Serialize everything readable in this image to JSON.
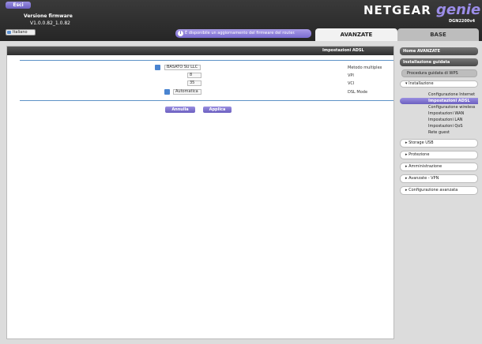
{
  "header": {
    "exit_label": "Esci",
    "firmware_label": "Versione firmware",
    "firmware_value": "V1.0.0.82_1.0.82",
    "language_value": "Italiano",
    "logo_brand": "NETGEAR",
    "logo_product": "genie",
    "model": "DGN2200v4",
    "update_notice": "È disponibile un aggiornamento del firmware del router.",
    "tabs": {
      "advanced": "AVANZATE",
      "basic": "BASE"
    }
  },
  "main": {
    "title": "Impostazioni ADSL",
    "fields": [
      {
        "label": "Metodo multiplex",
        "value": "BASATO SU LLC"
      },
      {
        "label": "VPI",
        "value": "8"
      },
      {
        "label": "VCI",
        "value": "35"
      },
      {
        "label": "DSL Mode",
        "value": "Automatica"
      }
    ],
    "apply_label": "Applica",
    "cancel_label": "Annulla"
  },
  "sidebar": {
    "home": "Home AVANZATE",
    "setup_wizard": "Installazione guidata",
    "wps_wizard": "Procedura guidata di WPS",
    "setup": "Installazione",
    "setup_items": [
      "Configurazione Internet",
      "Impostazioni ADSL",
      "Configurazione wireless",
      "Impostazioni WAN",
      "Impostazioni LAN",
      "Impostazioni QoS",
      "Rete guest"
    ],
    "groups": [
      "Storage USB",
      "Protezione",
      "Amministrazione",
      "Avanzate - VPN",
      "Configurazione avanzata"
    ]
  },
  "colors": {
    "accent": "#7a6cd0",
    "rule": "#5e93c7",
    "header_bg": "#2e2e2e"
  }
}
